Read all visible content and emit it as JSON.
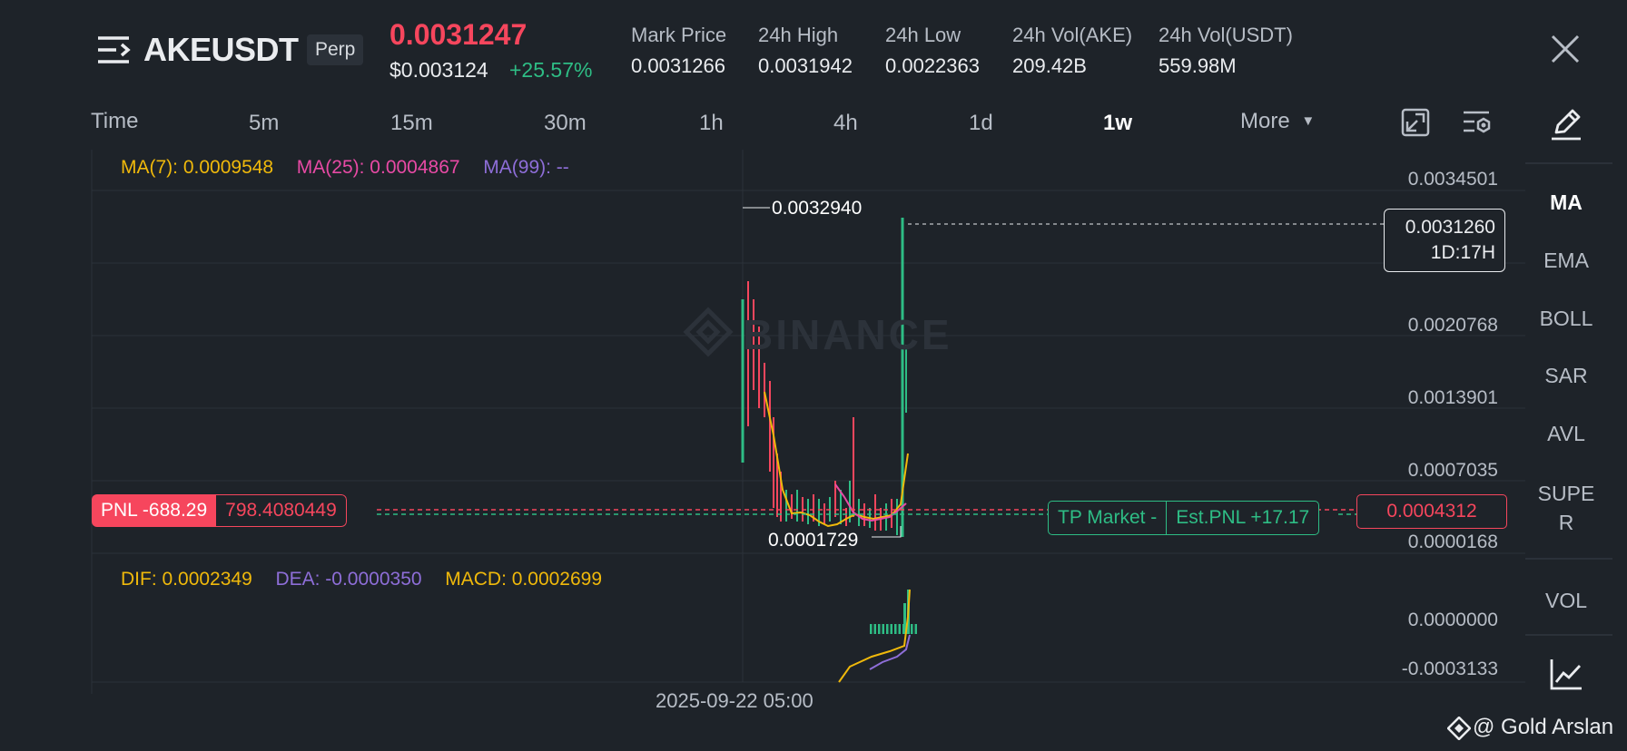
{
  "header": {
    "symbol": "AKEUSDT",
    "contract_badge": "Perp",
    "last_price": "0.0031247",
    "usd_price": "$0.003124",
    "change_pct": "+25.57%",
    "stats": [
      {
        "label": "Mark Price",
        "value": "0.0031266"
      },
      {
        "label": "24h High",
        "value": "0.0031942"
      },
      {
        "label": "24h Low",
        "value": "0.0022363"
      },
      {
        "label": "24h Vol(AKE)",
        "value": "209.42B"
      },
      {
        "label": "24h Vol(USDT)",
        "value": "559.98M"
      }
    ],
    "menu_icon": "menu-lines-icon",
    "close_icon": "close-icon"
  },
  "toolbar": {
    "timeframes": [
      "Time",
      "5m",
      "15m",
      "30m",
      "1h",
      "4h",
      "1d",
      "1w"
    ],
    "active_timeframe": "1w",
    "more_label": "More",
    "icons": [
      "fullscreen-icon",
      "chart-settings-icon",
      "draw-pen-icon"
    ]
  },
  "sidebar": {
    "items": [
      "MA",
      "EMA",
      "BOLL",
      "SAR",
      "AVL",
      "SUPER",
      "VOL"
    ],
    "active": "MA",
    "bottom_icon": "indicator-chart-icon"
  },
  "legend_main": {
    "ma7": "MA(7): 0.0009548",
    "ma25": "MA(25): 0.0004867",
    "ma99": "MA(99): --"
  },
  "legend_macd": {
    "dif": "DIF: 0.0002349",
    "dea": "DEA: -0.0000350",
    "macd": "MACD: 0.0002699"
  },
  "price_axis": [
    "0.0034501",
    "0.0020768",
    "0.0013901",
    "0.0007035",
    "0.0000168"
  ],
  "macd_axis": [
    "0.0000000",
    "-0.0003133"
  ],
  "annotations": {
    "high_marker": "0.0032940",
    "low_marker": "0.0001729",
    "current_price_tag": "0.0031260",
    "countdown": "1D:17H",
    "position_price_tag": "0.0004312"
  },
  "position": {
    "pnl_label": "PNL -688.29",
    "entry_price": "798.4080449",
    "tp_label": "TP Market -",
    "est_pnl": "Est.PNL +17.17"
  },
  "x_axis": {
    "date_label": "2025-09-22 05:00"
  },
  "watermark": {
    "text": "BINANCE"
  },
  "footer": {
    "credit": "@ Gold Arslan"
  },
  "colors": {
    "bg": "#1e2329",
    "up": "#2ebd85",
    "down": "#f6465d",
    "ma7": "#f0b90b",
    "ma25": "#e84aa5",
    "ma99": "#8e6ed8"
  }
}
